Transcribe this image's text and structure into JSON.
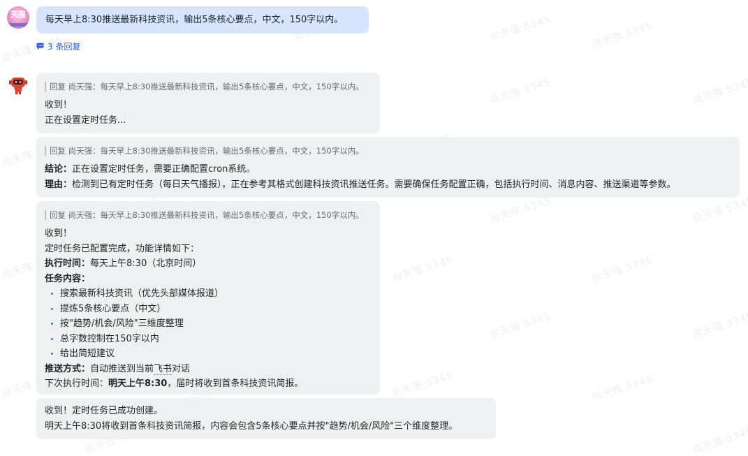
{
  "watermark": "尚天强 5345",
  "user": {
    "avatar_text": "天强",
    "message": "每天早上8:30推送最新科技资讯，输出5条核心要点，中文，150字以内。",
    "replies_label": "3 条回复"
  },
  "bot_messages": [
    {
      "quote": "回复 尚天强：每天早上8:30推送最新科技资讯，输出5条核心要点，中文，150字以内。",
      "lines": [
        "收到！",
        "正在设置定时任务..."
      ]
    },
    {
      "quote": "回复 尚天强：每天早上8:30推送最新科技资讯，输出5条核心要点，中文，150字以内。",
      "conclusion_label": "结论：",
      "conclusion": "正在设置定时任务，需要正确配置cron系统。",
      "reason_label": "理由：",
      "reason": "检测到已有定时任务（每日天气播报），正在参考其格式创建科技资讯推送任务。需要确保任务配置正确，包括执行时间、消息内容、推送渠道等参数。"
    },
    {
      "quote": "回复 尚天强：每天早上8:30推送最新科技资讯，输出5条核心要点，中文，150字以内。",
      "line1": "收到！",
      "line2": "定时任务已配置完成，功能详情如下：",
      "exec_label": "执行时间：",
      "exec_value": "每天上午8:30（北京时间）",
      "content_label": "任务内容：",
      "items": [
        "搜索最新科技资讯（优先头部媒体报道）",
        "提炼5条核心要点（中文）",
        "按\"趋势/机会/风险\"三维度整理",
        "总字数控制在150字以内",
        "给出简短建议"
      ],
      "push_label": "推送方式：",
      "push_value_a": "自动推送到当前",
      "push_value_b": "飞书",
      "push_value_c": "对话",
      "next_label": "下次执行时间：",
      "next_value": "明天上午8:30",
      "next_suffix": "，届时将收到首条科技资讯简报。"
    },
    {
      "lines": [
        "收到！定时任务已成功创建。",
        "明天上午8:30将收到首条科技资讯简报，内容会包含5条核心要点并按\"趋势/机会/风险\"三个维度整理。"
      ]
    }
  ],
  "colors": {
    "user_bubble": "#d7e5ff",
    "bot_bubble": "#eff0f1",
    "link": "#245bdb",
    "bullet": "#3370ff"
  },
  "icons": {
    "reply": "reply-thread-icon",
    "bot_avatar": "robot-avatar-icon"
  }
}
